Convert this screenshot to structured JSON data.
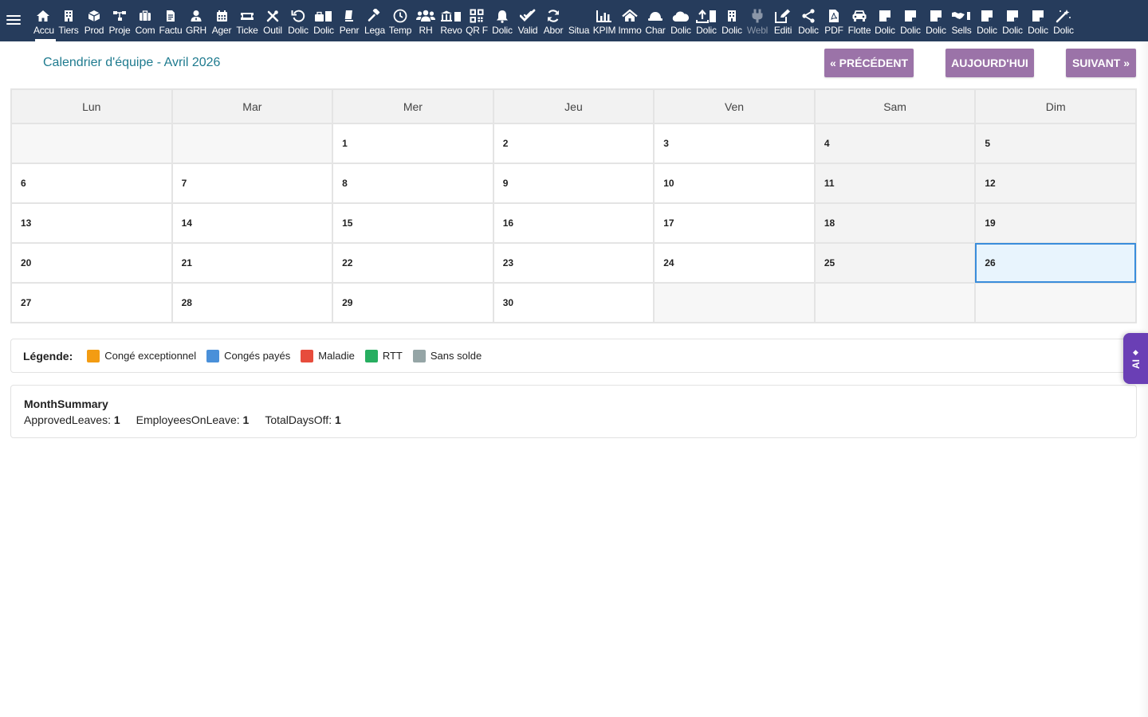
{
  "colors": {
    "topbar_bg": "#263c5c",
    "title_color": "#1f7b8f",
    "button_bg": "#9b73a8",
    "today_bg": "#e8f4fd",
    "today_border": "#3a8ddb",
    "ai_tab_bg": "#6a3fb5"
  },
  "topbar": {
    "menu_icon": "hamburger-icon",
    "items": [
      {
        "label": "Accu",
        "icon": "home-icon",
        "active": true
      },
      {
        "label": "Tiers",
        "icon": "building-icon"
      },
      {
        "label": "Prod",
        "icon": "cube-icon"
      },
      {
        "label": "Proje",
        "icon": "sitemap-icon"
      },
      {
        "label": "Com",
        "icon": "briefcase-icon"
      },
      {
        "label": "Factu",
        "icon": "invoice-icon"
      },
      {
        "label": "GRH",
        "icon": "user-tie-icon"
      },
      {
        "label": "Ager",
        "icon": "calendar-icon"
      },
      {
        "label": "Ticke",
        "icon": "ticket-icon"
      },
      {
        "label": "Outil",
        "icon": "tools-icon"
      },
      {
        "label": "Dolic",
        "icon": "undo-icon"
      },
      {
        "label": "Dolic",
        "icon": "toolbox-icon"
      },
      {
        "label": "Penr",
        "icon": "stamp-icon"
      },
      {
        "label": "Lega",
        "icon": "gavel-icon"
      },
      {
        "label": "Temp",
        "icon": "clock-icon"
      },
      {
        "label": "RH",
        "icon": "users-icon"
      },
      {
        "label": "Revo",
        "icon": "bank-icon"
      },
      {
        "label": "QR F",
        "icon": "qrcode-icon"
      },
      {
        "label": "Dolic",
        "icon": "bell-icon"
      },
      {
        "label": "Valid",
        "icon": "check-double-icon"
      },
      {
        "label": "Abor",
        "icon": "sync-icon"
      },
      {
        "label": "Situa",
        "icon": "blank-icon"
      },
      {
        "label": "KPIM",
        "icon": "chart-bar-icon"
      },
      {
        "label": "Immo",
        "icon": "house-icon"
      },
      {
        "label": "Char",
        "icon": "hard-hat-icon"
      },
      {
        "label": "Dolic",
        "icon": "cloud-icon"
      },
      {
        "label": "Dolic",
        "icon": "upload-icon"
      },
      {
        "label": "Dolic",
        "icon": "building-icon"
      },
      {
        "label": "Webl",
        "icon": "plug-icon",
        "disabled": true
      },
      {
        "label": "Editi",
        "icon": "edit-icon"
      },
      {
        "label": "Dolic",
        "icon": "share-icon"
      },
      {
        "label": "PDF",
        "icon": "pdf-icon"
      },
      {
        "label": "Flotte",
        "icon": "car-icon"
      },
      {
        "label": "Dolic",
        "icon": "note-icon"
      },
      {
        "label": "Dolic",
        "icon": "note-icon"
      },
      {
        "label": "Dolic",
        "icon": "note-icon"
      },
      {
        "label": "Sells",
        "icon": "handshake-icon"
      },
      {
        "label": "Dolic",
        "icon": "note-icon"
      },
      {
        "label": "Dolic",
        "icon": "note-icon"
      },
      {
        "label": "Dolic",
        "icon": "note-icon"
      },
      {
        "label": "Dolic",
        "icon": "magic-icon"
      }
    ]
  },
  "header": {
    "title": "Calendrier d'équipe - Avril 2026",
    "prev_label": "« PRÉCÉDENT",
    "today_label": "AUJOURD'HUI",
    "next_label": "SUIVANT »"
  },
  "calendar": {
    "weekdays": [
      "Lun",
      "Mar",
      "Mer",
      "Jeu",
      "Ven",
      "Sam",
      "Dim"
    ],
    "weeks": [
      [
        "",
        "",
        "1",
        "2",
        "3",
        "4",
        "5"
      ],
      [
        "6",
        "7",
        "8",
        "9",
        "10",
        "11",
        "12"
      ],
      [
        "13",
        "14",
        "15",
        "16",
        "17",
        "18",
        "19"
      ],
      [
        "20",
        "21",
        "22",
        "23",
        "24",
        "25",
        "26"
      ],
      [
        "27",
        "28",
        "29",
        "30",
        "",
        "",
        ""
      ]
    ],
    "today": "26"
  },
  "legend": {
    "title": "Légende:",
    "items": [
      {
        "label": "Congé exceptionnel",
        "color": "#f39c12"
      },
      {
        "label": "Congés payés",
        "color": "#4a90d9"
      },
      {
        "label": "Maladie",
        "color": "#e74c3c"
      },
      {
        "label": "RTT",
        "color": "#27ae60"
      },
      {
        "label": "Sans solde",
        "color": "#95a5a6"
      }
    ]
  },
  "summary": {
    "title": "MonthSummary",
    "stats": [
      {
        "label": "ApprovedLeaves:",
        "value": "1"
      },
      {
        "label": "EmployeesOnLeave:",
        "value": "1"
      },
      {
        "label": "TotalDaysOff:",
        "value": "1"
      }
    ]
  },
  "ai_tab": {
    "label": "AI",
    "icon": "sparkle-icon"
  }
}
